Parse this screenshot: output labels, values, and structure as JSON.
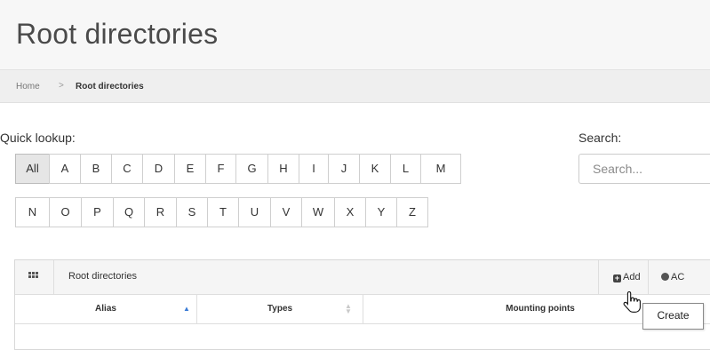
{
  "page": {
    "title": "Root directories"
  },
  "breadcrumb": {
    "home": "Home",
    "separator": ">",
    "current": "Root directories"
  },
  "quick_lookup": {
    "label": "Quick lookup:",
    "row1": [
      "All",
      "A",
      "B",
      "C",
      "D",
      "E",
      "F",
      "G",
      "H",
      "I",
      "J",
      "K",
      "L",
      "M"
    ],
    "row2": [
      "N",
      "O",
      "P",
      "Q",
      "R",
      "S",
      "T",
      "U",
      "V",
      "W",
      "X",
      "Y",
      "Z"
    ],
    "active": "All"
  },
  "search": {
    "label": "Search:",
    "placeholder": "Search...",
    "value": ""
  },
  "panel": {
    "title": "Root directories",
    "add_label": "Add",
    "acl_label": "AC",
    "columns": {
      "alias": "Alias",
      "types": "Types",
      "mounting_points": "Mounting points"
    }
  },
  "tooltip": {
    "text": "Create"
  },
  "icons": {
    "panel_menu": "grid-icon",
    "add": "plus-square-icon",
    "acl": "lock-icon",
    "cursor": "hand-pointer-icon"
  },
  "colors": {
    "header_bg": "#f7f7f7",
    "breadcrumb_bg": "#efefef",
    "active_letter_bg": "#e6e6e6",
    "sort_active": "#3a7bd5"
  }
}
